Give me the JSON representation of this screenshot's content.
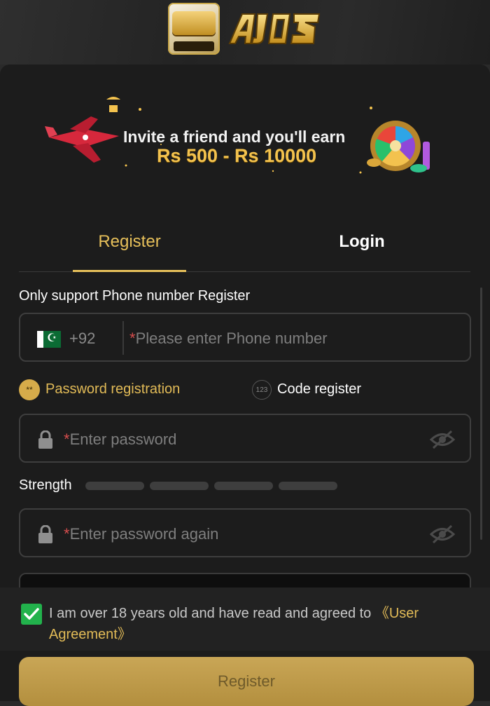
{
  "header": {
    "tile_logo_text": "AJ03",
    "tile_logo_subtext": "AJ03",
    "wordmark": "AJ03"
  },
  "banner": {
    "line1": "Invite a friend and you'll earn",
    "line2": "Rs 500 - Rs 10000"
  },
  "tabs": [
    {
      "label": "Register",
      "active": true
    },
    {
      "label": "Login",
      "active": false
    }
  ],
  "form": {
    "section_label": "Only support Phone number Register",
    "phone": {
      "country_code": "+92",
      "required_mark": "*",
      "placeholder": "Please enter Phone number"
    },
    "methods": {
      "password_label": "Password registration",
      "password_icon_text": "**",
      "code_label": "Code register",
      "code_icon_text": "123"
    },
    "password": {
      "required_mark": "*",
      "placeholder": "Enter password"
    },
    "strength_label": "Strength",
    "confirm_password": {
      "required_mark": "*",
      "placeholder": "Enter password again"
    },
    "agreement": {
      "checked": true,
      "text": "I am over 18 years old and have read and agreed to ",
      "link": "《User Agreement》"
    },
    "submit_label": "Register"
  },
  "colors": {
    "accent": "#e7c05a",
    "button": "#c9a656",
    "checkbox": "#22b24c",
    "background": "#1c1c1c"
  }
}
